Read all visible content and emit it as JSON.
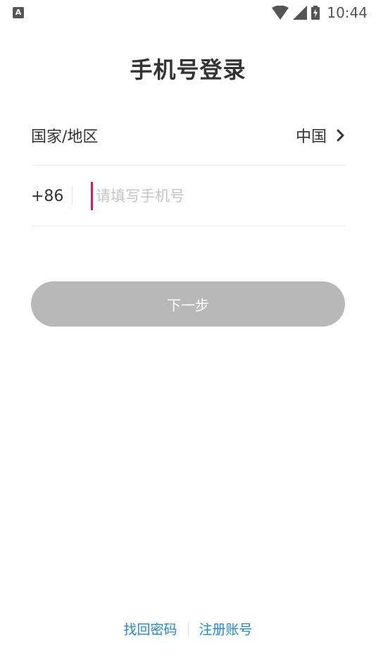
{
  "status_bar": {
    "left_icon_letter": "A",
    "time": "10:44",
    "icons": [
      "wifi-icon",
      "signal-icon",
      "battery-charging-icon"
    ]
  },
  "page": {
    "title": "手机号登录"
  },
  "region_row": {
    "label": "国家/地区",
    "value": "中国",
    "icon": "chevron-right-icon"
  },
  "phone_row": {
    "country_code": "+86",
    "placeholder": "请填写手机号",
    "value": ""
  },
  "next_button": {
    "label": "下一步",
    "enabled": false
  },
  "footer": {
    "recover_password": "找回密码",
    "register_account": "注册账号"
  },
  "colors": {
    "link": "#1e88d0",
    "button_disabled": "#b8b8b8",
    "cursor": "#d81b60",
    "text": "#333333"
  }
}
